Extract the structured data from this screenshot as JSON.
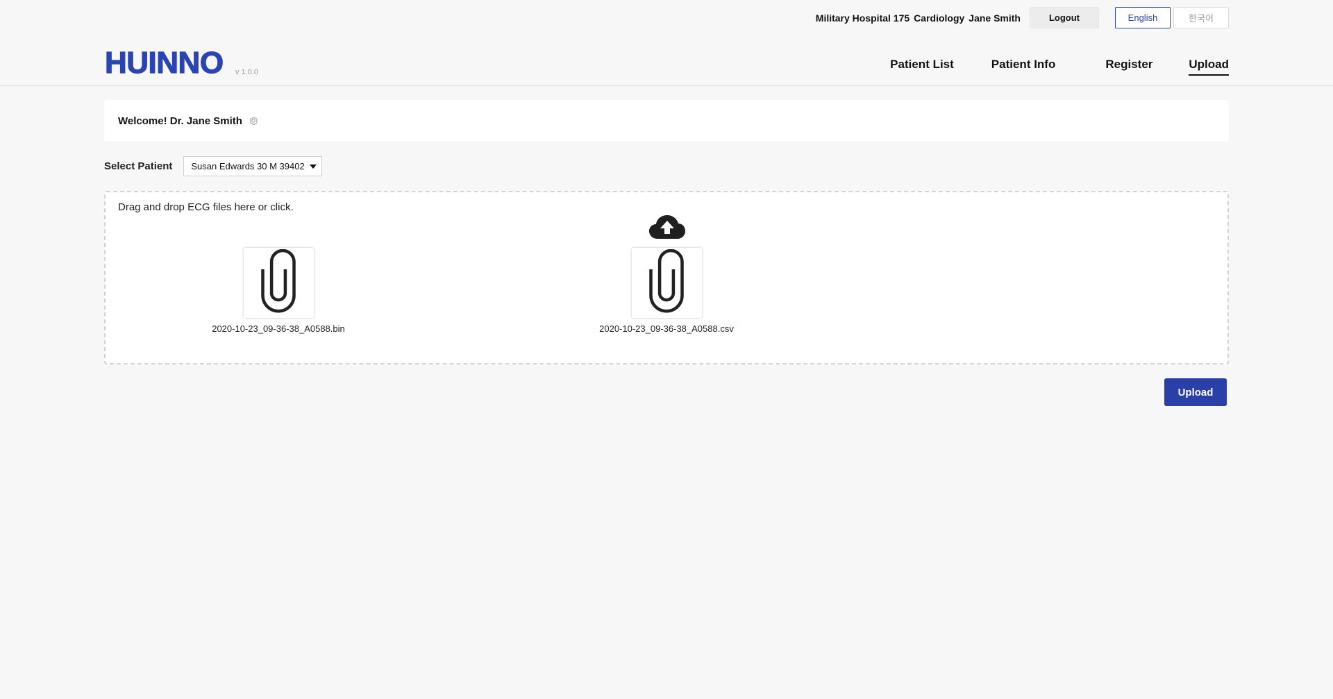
{
  "topbar": {
    "hospital": "Military Hospital 175",
    "department": "Cardiology",
    "user": "Jane Smith",
    "logout_label": "Logout",
    "languages": [
      "English",
      "한국어"
    ],
    "active_language": "English"
  },
  "header": {
    "logo": "HUINNO",
    "version": "v 1.0.0",
    "nav": [
      "Patient List",
      "Patient Info",
      "Register",
      "Upload"
    ],
    "active_nav": "Upload"
  },
  "welcome": {
    "text": "Welcome! Dr. Jane Smith"
  },
  "select_patient": {
    "label": "Select Patient",
    "selected": "Susan Edwards 30 M 39402"
  },
  "dropzone": {
    "instruction": "Drag and drop ECG files here or click.",
    "files": [
      "2020-10-23_09-36-38_A0588.bin",
      "2020-10-23_09-36-38_A0588.csv"
    ]
  },
  "actions": {
    "upload_label": "Upload"
  },
  "colors": {
    "brand": "#2a45b3",
    "primary_button": "#2a40a8",
    "background": "#f7f7f7"
  },
  "icons": {
    "settings": "gear-icon",
    "upload": "cloud-upload-icon",
    "file": "paperclip-icon",
    "dropdown": "caret-down-icon"
  }
}
